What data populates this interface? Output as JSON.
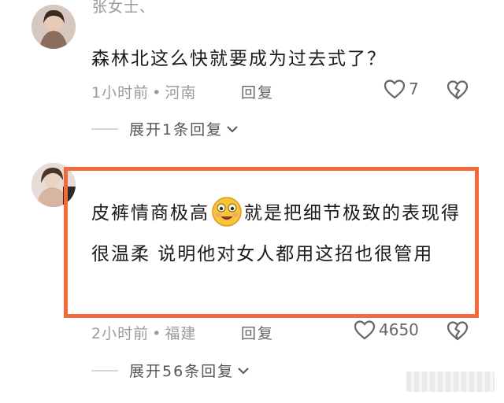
{
  "comments": [
    {
      "username": "张女士、",
      "text": "森林北这么快就要成为过去式了？",
      "time": "1小时前",
      "location": "河南",
      "reply_label": "回复",
      "likes": "7",
      "expand_label": "展开1条回复"
    },
    {
      "text_part1": "皮裤情商极高",
      "text_part2": "就是把细节极致的表现得很温柔 说明他对女人都用这招也很管用",
      "time": "2小时前",
      "location": "福建",
      "reply_label": "回复",
      "likes": "4650",
      "expand_label": "展开56条回复"
    }
  ],
  "meta_separator": "•",
  "icons": {
    "like": "heart-outline-icon",
    "dislike": "broken-heart-icon",
    "expand": "chevron-down-icon",
    "emoji": "smiling-face-emoji"
  },
  "colors": {
    "highlight_border": "#f26a3a",
    "text": "#1a1a1a",
    "meta": "#9a9a9a"
  }
}
